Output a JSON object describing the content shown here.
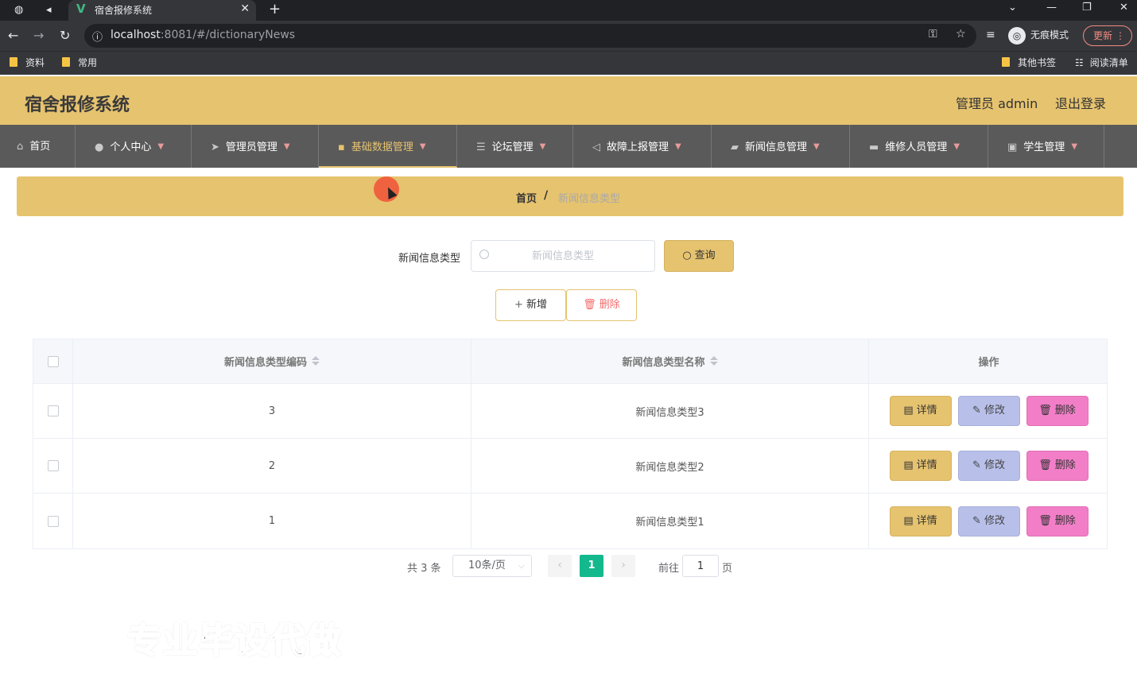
{
  "browser": {
    "tab_title": "宿舍报修系统",
    "url_host": "localhost",
    "url_rest": ":8081/#/dictionaryNews",
    "incognito_label": "无痕模式",
    "update_label": "更新",
    "bookmarks": [
      "资料",
      "常用"
    ],
    "bookmarks_right": [
      "其他书签",
      "阅读清单"
    ]
  },
  "header": {
    "title": "宿舍报修系统",
    "user": "管理员 admin",
    "logout": "退出登录"
  },
  "menu": {
    "items": [
      {
        "label": "首页",
        "icon": "home-icon"
      },
      {
        "label": "个人中心",
        "icon": "user-icon"
      },
      {
        "label": "管理员管理",
        "icon": "send-icon"
      },
      {
        "label": "基础数据管理",
        "icon": "stamp-icon"
      },
      {
        "label": "论坛管理",
        "icon": "sliders-icon"
      },
      {
        "label": "故障上报管理",
        "icon": "navigation-icon"
      },
      {
        "label": "新闻信息管理",
        "icon": "briefcase-icon"
      },
      {
        "label": "维修人员管理",
        "icon": "monitor-icon"
      },
      {
        "label": "学生管理",
        "icon": "chat-icon"
      }
    ],
    "active": "基础数据管理"
  },
  "breadcrumb": {
    "home": "首页",
    "separator": "/",
    "current": "新闻信息类型"
  },
  "search": {
    "label": "新闻信息类型",
    "placeholder": "新闻信息类型",
    "query_button": "查询"
  },
  "actions": {
    "add": "新增",
    "delete": "删除"
  },
  "table": {
    "columns": [
      "新闻信息类型编码",
      "新闻信息类型名称",
      "操作"
    ],
    "rows": [
      {
        "code": "3",
        "name": "新闻信息类型3"
      },
      {
        "code": "2",
        "name": "新闻信息类型2"
      },
      {
        "code": "1",
        "name": "新闻信息类型1"
      }
    ],
    "row_actions": {
      "detail": "详情",
      "edit": "修改",
      "delete": "删除"
    }
  },
  "pagination": {
    "total": "共 3 条",
    "page_size": "10条/页",
    "current_page": "1",
    "goto_label": "前往",
    "goto_value": "1",
    "goto_unit": "页"
  },
  "watermark": "专业毕设代做",
  "colors": {
    "brand": "#e6c36f",
    "menu_bg": "#5a5a5a",
    "page_active": "#13b98c",
    "edit_btn": "#b8c0ea",
    "delete_btn": "#f27ec8"
  }
}
